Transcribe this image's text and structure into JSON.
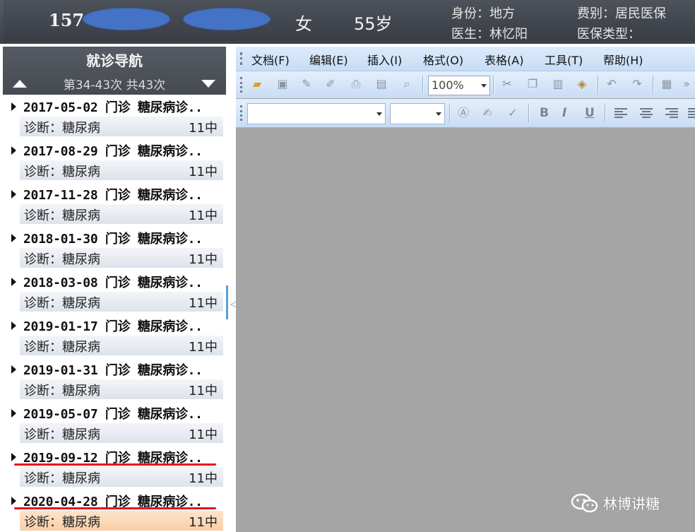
{
  "patient": {
    "id_prefix": "157",
    "gender": "女",
    "age": "55岁",
    "identity": "身份：地方",
    "fee_type": "费别：居民医保",
    "doctor": "医生：林忆阳",
    "insurance_type": "医保类型："
  },
  "nav": {
    "title": "就诊导航",
    "range": "第34-43次 共43次",
    "visits": [
      {
        "title": "2017-05-02 门诊 糖尿病诊..",
        "diagnosis": "诊断：糖尿病",
        "dept": "11中",
        "underlined": false,
        "selected": false
      },
      {
        "title": "2017-08-29 门诊 糖尿病诊..",
        "diagnosis": "诊断：糖尿病",
        "dept": "11中",
        "underlined": false,
        "selected": false
      },
      {
        "title": "2017-11-28 门诊 糖尿病诊..",
        "diagnosis": "诊断：糖尿病",
        "dept": "11中",
        "underlined": false,
        "selected": false
      },
      {
        "title": "2018-01-30 门诊 糖尿病诊..",
        "diagnosis": "诊断：糖尿病",
        "dept": "11中",
        "underlined": false,
        "selected": false
      },
      {
        "title": "2018-03-08 门诊 糖尿病诊..",
        "diagnosis": "诊断：糖尿病",
        "dept": "11中",
        "underlined": false,
        "selected": false
      },
      {
        "title": "2019-01-17 门诊 糖尿病诊..",
        "diagnosis": "诊断：糖尿病",
        "dept": "11中",
        "underlined": false,
        "selected": false
      },
      {
        "title": "2019-01-31 门诊 糖尿病诊..",
        "diagnosis": "诊断：糖尿病",
        "dept": "11中",
        "underlined": false,
        "selected": false
      },
      {
        "title": "2019-05-07 门诊 糖尿病诊..",
        "diagnosis": "诊断：糖尿病",
        "dept": "11中",
        "underlined": false,
        "selected": false
      },
      {
        "title": "2019-09-12 门诊 糖尿病诊..",
        "diagnosis": "诊断：糖尿病",
        "dept": "11中",
        "underlined": true,
        "selected": false
      },
      {
        "title": "2020-04-28 门诊 糖尿病诊..",
        "diagnosis": "诊断：糖尿病",
        "dept": "11中",
        "underlined": true,
        "selected": true
      }
    ]
  },
  "menu": {
    "items": [
      "文档(F)",
      "编辑(E)",
      "插入(I)",
      "格式(O)",
      "表格(A)",
      "工具(T)",
      "帮助(H)"
    ]
  },
  "toolbar": {
    "zoom": "100%",
    "icons": [
      "open-folder-icon",
      "save-icon",
      "pencil-icon",
      "eraser-icon",
      "print-icon",
      "print-setup-icon",
      "print-preview-icon",
      "cut-icon",
      "copy-icon",
      "paste-icon",
      "paste-special-icon",
      "undo-icon",
      "redo-icon",
      "table-icon",
      "more-icon"
    ]
  },
  "format_bar": {
    "bold": "B",
    "italic": "I",
    "underline": "U"
  },
  "watermark": {
    "text": "林博讲糖"
  },
  "colors": {
    "header_bg": "#44484f",
    "mask_blue": "#4472c4",
    "red_underline": "#e8141c",
    "selected_row": "#fbd9b8",
    "editor_bg": "#a5a5a5",
    "toolbar_blue": "#d2e3f8"
  }
}
